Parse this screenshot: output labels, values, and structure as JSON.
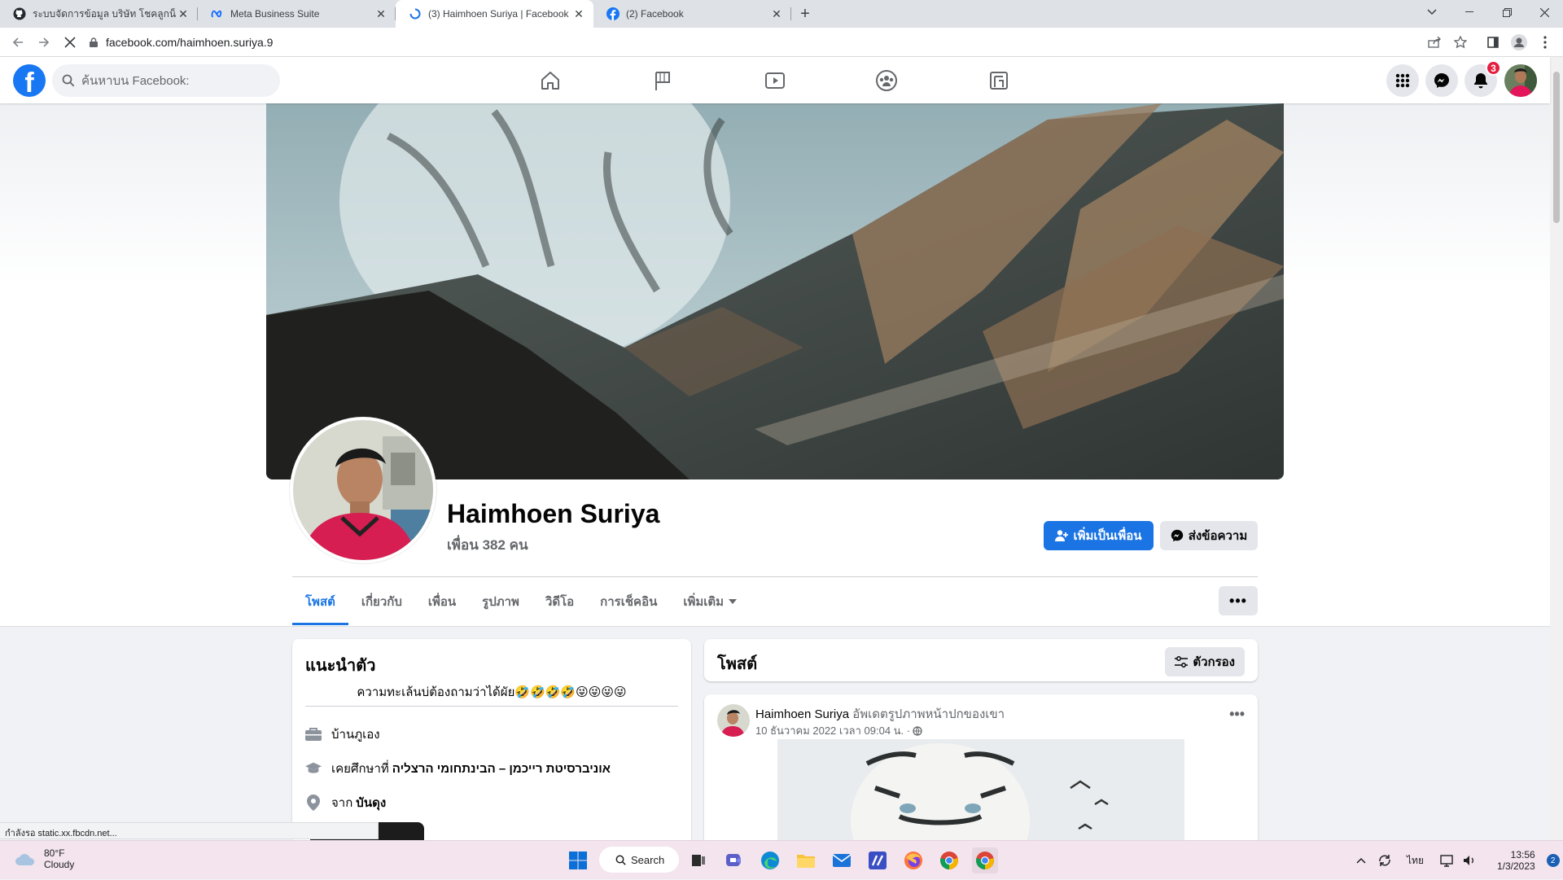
{
  "browser": {
    "tabs": [
      {
        "title": "ระบบจัดการข้อมูล บริษัท โชคลูกน็อต จำกัด",
        "icon": "github-icon",
        "active": false
      },
      {
        "title": "Meta Business Suite",
        "icon": "meta-icon",
        "active": false
      },
      {
        "title": "(3) Haimhoen Suriya | Facebook",
        "icon": "loading-icon",
        "active": true
      },
      {
        "title": "(2) Facebook",
        "icon": "facebook-icon",
        "active": false
      }
    ],
    "close_glyph": "✕",
    "new_tab_glyph": "+",
    "url": "facebook.com/haimhoen.suriya.9"
  },
  "fb_header": {
    "logo": "f",
    "search_placeholder": "ค้นหาบน Facebook:",
    "notification_count": "3",
    "nav_icons": [
      "home-icon",
      "pages-flag-icon",
      "watch-video-icon",
      "groups-icon",
      "gaming-icon"
    ]
  },
  "profile": {
    "name": "Haimhoen Suriya",
    "friends": "เพื่อน 382 คน",
    "add_friend_label": "เพิ่มเป็นเพื่อน",
    "message_label": "ส่งข้อความ",
    "tabs": [
      "โพสต์",
      "เกี่ยวกับ",
      "เพื่อน",
      "รูปภาพ",
      "วิดีโอ",
      "การเช็คอิน",
      "เพิ่มเติม"
    ],
    "more_glyph": "•••"
  },
  "intro": {
    "title": "แนะนำตัว",
    "bio": "ความทะเล้นบ่ต้องถามว่าได้ผัย🤣🤣🤣🤣😜😜😜😜",
    "home_label": "บ้านภูเอง",
    "studied_prefix": "เคยศึกษาที่",
    "studied_value": "אוניברסיטת רייכמן – הבינתחומי הרצליה",
    "from_prefix": "จาก",
    "from_value": "บันดุง"
  },
  "posts": {
    "title": "โพสต์",
    "filter_label": "ตัวกรอง",
    "post": {
      "author": "Haimhoen Suriya",
      "action": "อัพเดตรูปภาพหน้าปกของเขา",
      "time": "10 ธันวาคม 2022 เวลา 09:04 น. ·",
      "more_glyph": "•••"
    }
  },
  "status_text": "กำลังรอ static.xx.fbcdn.net...",
  "taskbar": {
    "temp": "80°F",
    "condition": "Cloudy",
    "search_label": "Search",
    "lang": "ไทย",
    "time": "13:56",
    "date": "1/3/2023",
    "notif_count": "2"
  },
  "colors": {
    "fb_blue": "#1b74e4",
    "badge_red": "#e41e3f",
    "page_bg": "#f0f2f5"
  }
}
